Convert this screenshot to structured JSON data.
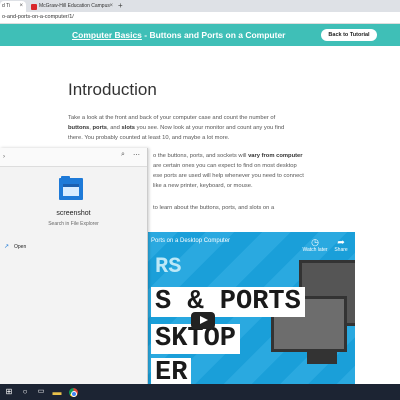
{
  "browser": {
    "tabs": [
      {
        "label": "d Ti",
        "active": true
      },
      {
        "label": "McGraw-Hill Education Campus",
        "active": false
      }
    ],
    "new_tab_label": "+",
    "url": "o-and-ports-on-a-computer/1/"
  },
  "site": {
    "title_link": "Computer Basics",
    "title_rest": " - Buttons and Ports on a Computer",
    "back_button": "Back to Tutorial",
    "header_color": "#3fbfb7"
  },
  "article": {
    "heading": "Introduction",
    "p1_a": "Take a look at the front and back of your computer case and count the number of",
    "p1_b1": "buttons",
    "p1_b2": "ports",
    "p1_b3": "slots",
    "p1_c": "you see. Now look at your monitor and count any you find",
    "p1_d": "there. You probably counted at least 10, and maybe a lot more.",
    "p2_a": "o the buttons, ports, and sockets will",
    "p2_bold": "vary from computer",
    "p2_b": "are certain ones you can expect to find on most desktop",
    "p2_c": "ese ports are used will help whenever you need to connect",
    "p2_d": "like a new printer, keyboard, or mouse.",
    "p3_a": "to learn about the buttons, ports, and slots on a"
  },
  "video": {
    "title": "Ports on a Desktop Computer",
    "watch_later": "Watch later",
    "share": "Share",
    "big_line1": "RS",
    "big_line2": "S & PORTS",
    "big_line3": "SKTOP",
    "big_line4": "ER"
  },
  "popup": {
    "item_name": "screenshot",
    "item_sub": "Search in File Explorer",
    "open_label": "Open"
  },
  "colors": {
    "accent": "#3fbfb7",
    "taskbar": "#1c2433",
    "video_bg": "#1a9fd9"
  }
}
